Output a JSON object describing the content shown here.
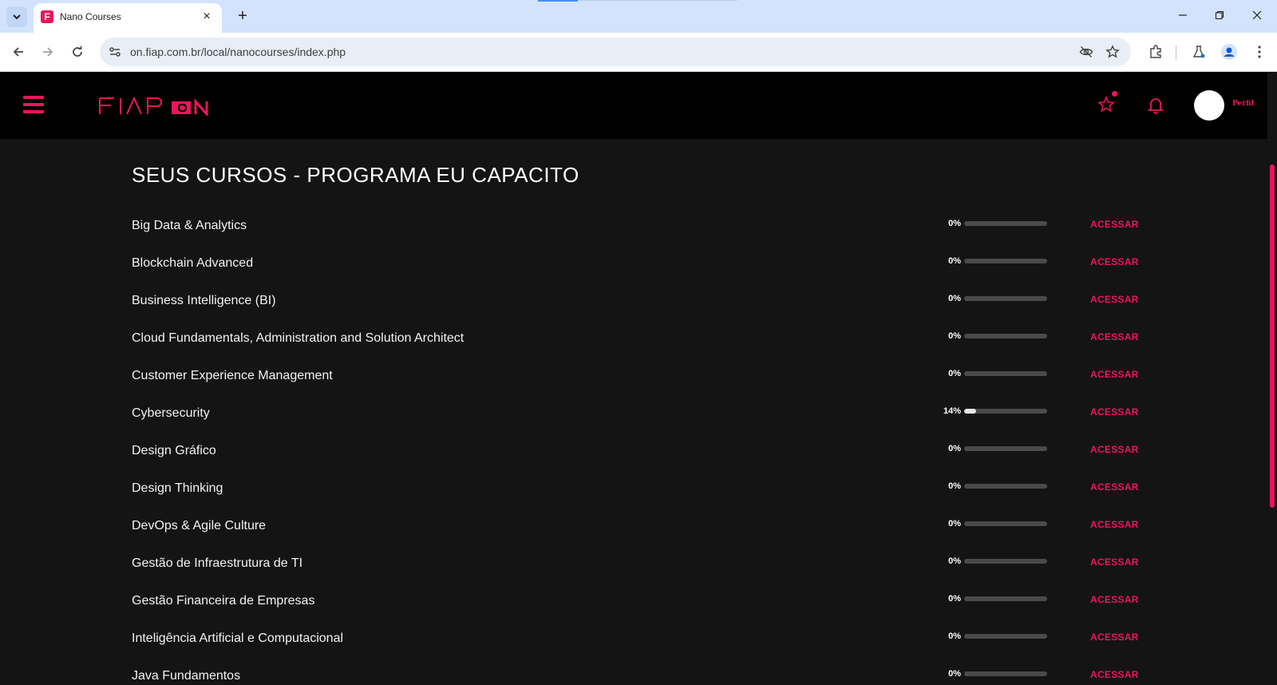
{
  "browser": {
    "tab_title": "Nano Courses",
    "tab_favicon_letter": "F",
    "url": "on.fiap.com.br/local/nanocourses/index.php"
  },
  "header": {
    "profile_label": "Perfil",
    "brand_color": "#ed145b"
  },
  "main": {
    "title": "SEUS CURSOS - PROGRAMA EU CAPACITO",
    "access_label": "ACESSAR",
    "courses": [
      {
        "name": "Big Data & Analytics",
        "progress_label": "0%",
        "progress": 0
      },
      {
        "name": "Blockchain Advanced",
        "progress_label": "0%",
        "progress": 0
      },
      {
        "name": "Business Intelligence (BI)",
        "progress_label": "0%",
        "progress": 0
      },
      {
        "name": "Cloud Fundamentals, Administration and Solution Architect",
        "progress_label": "0%",
        "progress": 0
      },
      {
        "name": "Customer Experience Management",
        "progress_label": "0%",
        "progress": 0
      },
      {
        "name": "Cybersecurity",
        "progress_label": "14%",
        "progress": 14
      },
      {
        "name": "Design Gráfico",
        "progress_label": "0%",
        "progress": 0
      },
      {
        "name": "Design Thinking",
        "progress_label": "0%",
        "progress": 0
      },
      {
        "name": "DevOps & Agile Culture",
        "progress_label": "0%",
        "progress": 0
      },
      {
        "name": "Gestão de Infraestrutura de TI",
        "progress_label": "0%",
        "progress": 0
      },
      {
        "name": "Gestão Financeira de Empresas",
        "progress_label": "0%",
        "progress": 0
      },
      {
        "name": "Inteligência Artificial e Computacional",
        "progress_label": "0%",
        "progress": 0
      },
      {
        "name": "Java Fundamentos",
        "progress_label": "0%",
        "progress": 0
      }
    ]
  }
}
